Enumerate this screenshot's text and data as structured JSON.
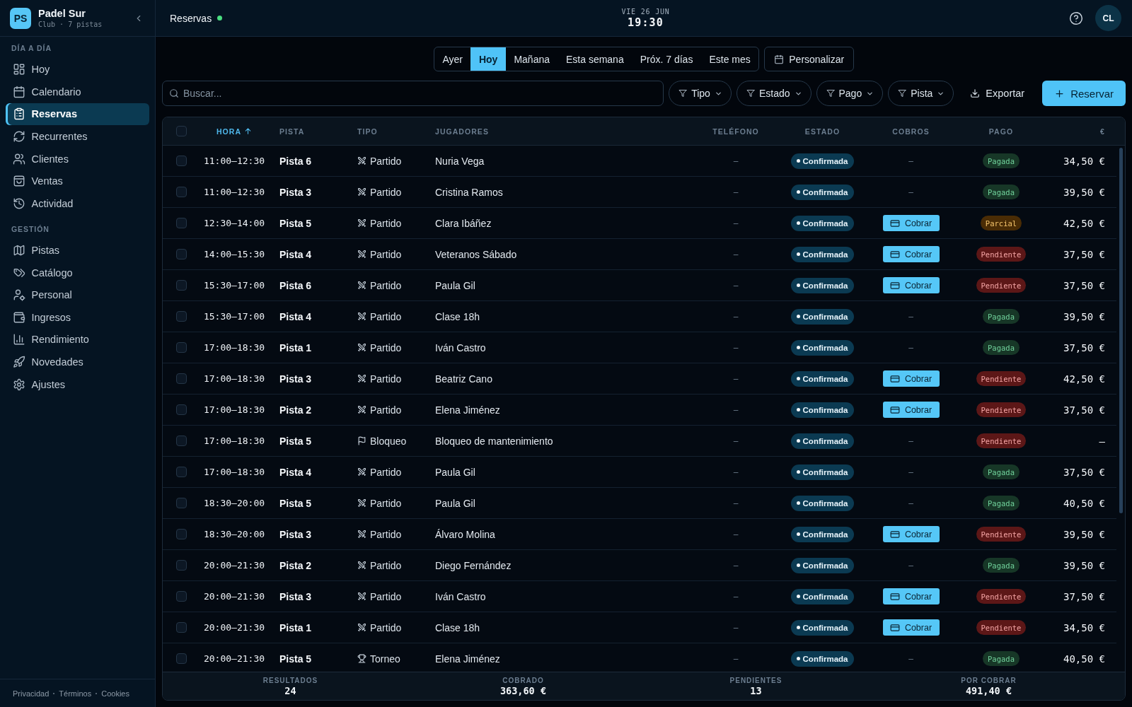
{
  "sidebar": {
    "club": {
      "logo": "PS",
      "name": "Padel Sur",
      "subtitle": "Club · 7 pistas"
    },
    "sections": [
      {
        "title": "DÍA A DÍA",
        "items": [
          {
            "label": "Hoy",
            "selected": false
          },
          {
            "label": "Calendario",
            "selected": false
          },
          {
            "label": "Reservas",
            "selected": true
          },
          {
            "label": "Recurrentes",
            "selected": false
          },
          {
            "label": "Clientes",
            "selected": false
          },
          {
            "label": "Ventas",
            "selected": false
          },
          {
            "label": "Actividad",
            "selected": false
          }
        ]
      },
      {
        "title": "GESTIÓN",
        "items": [
          {
            "label": "Pistas",
            "selected": false
          },
          {
            "label": "Catálogo",
            "selected": false
          },
          {
            "label": "Personal",
            "selected": false
          },
          {
            "label": "Ingresos",
            "selected": false
          },
          {
            "label": "Rendimiento",
            "selected": false
          },
          {
            "label": "Novedades",
            "selected": false
          },
          {
            "label": "Ajustes",
            "selected": false
          }
        ]
      }
    ],
    "footer_links": [
      "Privacidad",
      "Términos",
      "Cookies"
    ]
  },
  "top_bar": {
    "title": "Reservas",
    "date": "VIE 26 JUN",
    "time": "19:30",
    "avatar": "CL"
  },
  "date_range": {
    "tabs": [
      {
        "label": "Ayer",
        "selected": false
      },
      {
        "label": "Hoy",
        "selected": true
      },
      {
        "label": "Mañana",
        "selected": false
      },
      {
        "label": "Esta semana",
        "selected": false
      },
      {
        "label": "Próx. 7 días",
        "selected": false
      },
      {
        "label": "Este mes",
        "selected": false
      }
    ],
    "custom_button": "Personalizar"
  },
  "toolbar": {
    "search": {
      "placeholder": "Buscar..."
    },
    "filters": [
      "Tipo",
      "Estado",
      "Pago",
      "Pista"
    ],
    "export_button": "Exportar",
    "new_button": "Reservar"
  },
  "table": {
    "header_checkbox": {
      "checked": false
    },
    "columns": [
      {
        "label": "HORA",
        "sorted": true
      },
      {
        "label": "PISTA",
        "sorted": false
      },
      {
        "label": "TIPO",
        "sorted": false
      },
      {
        "label": "JUGADORES",
        "sorted": false
      },
      {
        "label": "TELÉFONO",
        "sorted": false
      },
      {
        "label": "ESTADO",
        "sorted": false
      },
      {
        "label": "COBROS",
        "sorted": false
      },
      {
        "label": "PAGO",
        "sorted": false
      },
      {
        "label": "€",
        "sorted": false
      }
    ],
    "rows": [
      {
        "checked": false,
        "time": "11:00–12:30",
        "court": "Pista 6",
        "type": {
          "kind": "match",
          "label": "Partido"
        },
        "players": "Nuria Vega",
        "phone": "–",
        "status": "Confirmada",
        "charge": {
          "kind": "none",
          "label": "–"
        },
        "payment": {
          "kind": "paid",
          "label": "Pagada"
        },
        "amount": "34,50 €"
      },
      {
        "checked": false,
        "time": "11:00–12:30",
        "court": "Pista 3",
        "type": {
          "kind": "match",
          "label": "Partido"
        },
        "players": "Cristina Ramos",
        "phone": "–",
        "status": "Confirmada",
        "charge": {
          "kind": "none",
          "label": "–"
        },
        "payment": {
          "kind": "paid",
          "label": "Pagada"
        },
        "amount": "39,50 €"
      },
      {
        "checked": false,
        "time": "12:30–14:00",
        "court": "Pista 5",
        "type": {
          "kind": "match",
          "label": "Partido"
        },
        "players": "Clara Ibáñez",
        "phone": "–",
        "status": "Confirmada",
        "charge": {
          "kind": "button",
          "label": "Cobrar"
        },
        "payment": {
          "kind": "partial",
          "label": "Parcial"
        },
        "amount": "42,50 €"
      },
      {
        "checked": false,
        "time": "14:00–15:30",
        "court": "Pista 4",
        "type": {
          "kind": "match",
          "label": "Partido"
        },
        "players": "Veteranos Sábado",
        "phone": "–",
        "status": "Confirmada",
        "charge": {
          "kind": "button",
          "label": "Cobrar"
        },
        "payment": {
          "kind": "pending",
          "label": "Pendiente"
        },
        "amount": "37,50 €"
      },
      {
        "checked": false,
        "time": "15:30–17:00",
        "court": "Pista 6",
        "type": {
          "kind": "match",
          "label": "Partido"
        },
        "players": "Paula Gil",
        "phone": "–",
        "status": "Confirmada",
        "charge": {
          "kind": "button",
          "label": "Cobrar"
        },
        "payment": {
          "kind": "pending",
          "label": "Pendiente"
        },
        "amount": "37,50 €"
      },
      {
        "checked": false,
        "time": "15:30–17:00",
        "court": "Pista 4",
        "type": {
          "kind": "match",
          "label": "Partido"
        },
        "players": "Clase 18h",
        "phone": "–",
        "status": "Confirmada",
        "charge": {
          "kind": "none",
          "label": "–"
        },
        "payment": {
          "kind": "paid",
          "label": "Pagada"
        },
        "amount": "39,50 €"
      },
      {
        "checked": false,
        "time": "17:00–18:30",
        "court": "Pista 1",
        "type": {
          "kind": "match",
          "label": "Partido"
        },
        "players": "Iván Castro",
        "phone": "–",
        "status": "Confirmada",
        "charge": {
          "kind": "none",
          "label": "–"
        },
        "payment": {
          "kind": "paid",
          "label": "Pagada"
        },
        "amount": "37,50 €"
      },
      {
        "checked": false,
        "time": "17:00–18:30",
        "court": "Pista 3",
        "type": {
          "kind": "match",
          "label": "Partido"
        },
        "players": "Beatriz Cano",
        "phone": "–",
        "status": "Confirmada",
        "charge": {
          "kind": "button",
          "label": "Cobrar"
        },
        "payment": {
          "kind": "pending",
          "label": "Pendiente"
        },
        "amount": "42,50 €"
      },
      {
        "checked": false,
        "time": "17:00–18:30",
        "court": "Pista 2",
        "type": {
          "kind": "match",
          "label": "Partido"
        },
        "players": "Elena Jiménez",
        "phone": "–",
        "status": "Confirmada",
        "charge": {
          "kind": "button",
          "label": "Cobrar"
        },
        "payment": {
          "kind": "pending",
          "label": "Pendiente"
        },
        "amount": "37,50 €"
      },
      {
        "checked": false,
        "time": "17:00–18:30",
        "court": "Pista 5",
        "type": {
          "kind": "block",
          "label": "Bloqueo"
        },
        "players": "Bloqueo de mantenimiento",
        "phone": "–",
        "status": "Confirmada",
        "charge": {
          "kind": "none",
          "label": "–"
        },
        "payment": {
          "kind": "pending",
          "label": "Pendiente"
        },
        "amount": "–"
      },
      {
        "checked": false,
        "time": "17:00–18:30",
        "court": "Pista 4",
        "type": {
          "kind": "match",
          "label": "Partido"
        },
        "players": "Paula Gil",
        "phone": "–",
        "status": "Confirmada",
        "charge": {
          "kind": "none",
          "label": "–"
        },
        "payment": {
          "kind": "paid",
          "label": "Pagada"
        },
        "amount": "37,50 €"
      },
      {
        "checked": false,
        "time": "18:30–20:00",
        "court": "Pista 5",
        "type": {
          "kind": "match",
          "label": "Partido"
        },
        "players": "Paula Gil",
        "phone": "–",
        "status": "Confirmada",
        "charge": {
          "kind": "none",
          "label": "–"
        },
        "payment": {
          "kind": "paid",
          "label": "Pagada"
        },
        "amount": "40,50 €"
      },
      {
        "checked": false,
        "time": "18:30–20:00",
        "court": "Pista 3",
        "type": {
          "kind": "match",
          "label": "Partido"
        },
        "players": "Álvaro Molina",
        "phone": "–",
        "status": "Confirmada",
        "charge": {
          "kind": "button",
          "label": "Cobrar"
        },
        "payment": {
          "kind": "pending",
          "label": "Pendiente"
        },
        "amount": "39,50 €"
      },
      {
        "checked": false,
        "time": "20:00–21:30",
        "court": "Pista 2",
        "type": {
          "kind": "match",
          "label": "Partido"
        },
        "players": "Diego Fernández",
        "phone": "–",
        "status": "Confirmada",
        "charge": {
          "kind": "none",
          "label": "–"
        },
        "payment": {
          "kind": "paid",
          "label": "Pagada"
        },
        "amount": "39,50 €"
      },
      {
        "checked": false,
        "time": "20:00–21:30",
        "court": "Pista 3",
        "type": {
          "kind": "match",
          "label": "Partido"
        },
        "players": "Iván Castro",
        "phone": "–",
        "status": "Confirmada",
        "charge": {
          "kind": "button",
          "label": "Cobrar"
        },
        "payment": {
          "kind": "pending",
          "label": "Pendiente"
        },
        "amount": "37,50 €"
      },
      {
        "checked": false,
        "time": "20:00–21:30",
        "court": "Pista 1",
        "type": {
          "kind": "match",
          "label": "Partido"
        },
        "players": "Clase 18h",
        "phone": "–",
        "status": "Confirmada",
        "charge": {
          "kind": "button",
          "label": "Cobrar"
        },
        "payment": {
          "kind": "pending",
          "label": "Pendiente"
        },
        "amount": "34,50 €"
      },
      {
        "checked": false,
        "time": "20:00–21:30",
        "court": "Pista 5",
        "type": {
          "kind": "tournament",
          "label": "Torneo"
        },
        "players": "Elena Jiménez",
        "phone": "–",
        "status": "Confirmada",
        "charge": {
          "kind": "none",
          "label": "–"
        },
        "payment": {
          "kind": "paid",
          "label": "Pagada"
        },
        "amount": "40,50 €"
      }
    ]
  },
  "summary": [
    {
      "label": "RESULTADOS",
      "value": "24"
    },
    {
      "label": "COBRADO",
      "value": "363,60 €"
    },
    {
      "label": "PENDIENTES",
      "value": "13"
    },
    {
      "label": "POR COBRAR",
      "value": "491,40 €"
    }
  ]
}
